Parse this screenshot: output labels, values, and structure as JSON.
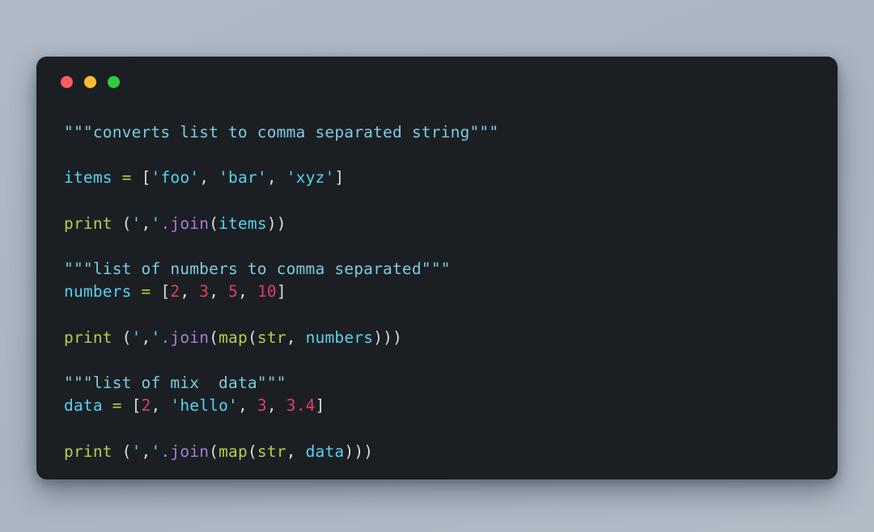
{
  "window": {
    "controls": [
      {
        "name": "close",
        "color": "#fa5c63"
      },
      {
        "name": "minimize",
        "color": "#fdbd2e"
      },
      {
        "name": "maximize",
        "color": "#2ecc40"
      }
    ]
  },
  "theme": {
    "page_background": "#adb8c5",
    "card_background": "#1b1f23",
    "docstring": "#7fcadf",
    "variable": "#57d2f0",
    "keyword": "#b6cd4b",
    "method": "#a77cd7",
    "number": "#dc415c",
    "punctuation": "#dcdcdc",
    "string": "#57d2f0"
  },
  "code": {
    "language": "python",
    "plain_text": "\"\"\"converts list to comma separated string\"\"\"\n\nitems = ['foo', 'bar', 'xyz']\n\nprint (','.join(items))\n\n\"\"\"list of numbers to comma separated\"\"\"\nnumbers = [2, 3, 5, 10]\n\nprint (','.join(map(str, numbers)))\n\n\"\"\"list of mix  data\"\"\"\ndata = [2, 'hello', 3, 3.4]\n\nprint (','.join(map(str, data)))",
    "lines": [
      {
        "id": "line-1",
        "tokens": [
          {
            "t": "\"\"\"converts list to comma separated string\"\"\"",
            "c": "doc"
          }
        ]
      },
      {
        "id": "line-2",
        "tokens": []
      },
      {
        "id": "line-3",
        "tokens": [
          {
            "t": "items",
            "c": "var"
          },
          {
            "t": " ",
            "c": "punct"
          },
          {
            "t": "=",
            "c": "op"
          },
          {
            "t": " ",
            "c": "punct"
          },
          {
            "t": "[",
            "c": "punct"
          },
          {
            "t": "'foo'",
            "c": "string"
          },
          {
            "t": ", ",
            "c": "punct"
          },
          {
            "t": "'bar'",
            "c": "string"
          },
          {
            "t": ", ",
            "c": "punct"
          },
          {
            "t": "'xyz'",
            "c": "string"
          },
          {
            "t": "]",
            "c": "punct"
          }
        ]
      },
      {
        "id": "line-4",
        "tokens": []
      },
      {
        "id": "line-5",
        "tokens": [
          {
            "t": "print",
            "c": "keyword"
          },
          {
            "t": " (",
            "c": "punct"
          },
          {
            "t": "'",
            "c": "string"
          },
          {
            "t": ",",
            "c": "punct"
          },
          {
            "t": "'",
            "c": "string"
          },
          {
            "t": ".join",
            "c": "method"
          },
          {
            "t": "(",
            "c": "punct"
          },
          {
            "t": "items",
            "c": "var"
          },
          {
            "t": "))",
            "c": "punct"
          }
        ]
      },
      {
        "id": "line-6",
        "tokens": []
      },
      {
        "id": "line-7",
        "tokens": [
          {
            "t": "\"\"\"list of numbers to comma separated\"\"\"",
            "c": "doc"
          }
        ]
      },
      {
        "id": "line-8",
        "tokens": [
          {
            "t": "numbers",
            "c": "var"
          },
          {
            "t": " ",
            "c": "punct"
          },
          {
            "t": "=",
            "c": "op"
          },
          {
            "t": " ",
            "c": "punct"
          },
          {
            "t": "[",
            "c": "punct"
          },
          {
            "t": "2",
            "c": "number"
          },
          {
            "t": ", ",
            "c": "punct"
          },
          {
            "t": "3",
            "c": "number"
          },
          {
            "t": ", ",
            "c": "punct"
          },
          {
            "t": "5",
            "c": "number"
          },
          {
            "t": ", ",
            "c": "punct"
          },
          {
            "t": "10",
            "c": "number"
          },
          {
            "t": "]",
            "c": "punct"
          }
        ]
      },
      {
        "id": "line-9",
        "tokens": []
      },
      {
        "id": "line-10",
        "tokens": [
          {
            "t": "print",
            "c": "keyword"
          },
          {
            "t": " (",
            "c": "punct"
          },
          {
            "t": "'",
            "c": "string"
          },
          {
            "t": ",",
            "c": "punct"
          },
          {
            "t": "'",
            "c": "string"
          },
          {
            "t": ".join",
            "c": "method"
          },
          {
            "t": "(",
            "c": "punct"
          },
          {
            "t": "map",
            "c": "keyword"
          },
          {
            "t": "(",
            "c": "punct"
          },
          {
            "t": "str",
            "c": "keyword"
          },
          {
            "t": ", ",
            "c": "punct"
          },
          {
            "t": "numbers",
            "c": "var"
          },
          {
            "t": ")))",
            "c": "punct"
          }
        ]
      },
      {
        "id": "line-11",
        "tokens": []
      },
      {
        "id": "line-12",
        "tokens": [
          {
            "t": "\"\"\"list of mix  data\"\"\"",
            "c": "doc"
          }
        ]
      },
      {
        "id": "line-13",
        "tokens": [
          {
            "t": "data",
            "c": "var"
          },
          {
            "t": " ",
            "c": "punct"
          },
          {
            "t": "=",
            "c": "op"
          },
          {
            "t": " ",
            "c": "punct"
          },
          {
            "t": "[",
            "c": "punct"
          },
          {
            "t": "2",
            "c": "number"
          },
          {
            "t": ", ",
            "c": "punct"
          },
          {
            "t": "'hello'",
            "c": "string"
          },
          {
            "t": ", ",
            "c": "punct"
          },
          {
            "t": "3",
            "c": "number"
          },
          {
            "t": ", ",
            "c": "punct"
          },
          {
            "t": "3.4",
            "c": "number"
          },
          {
            "t": "]",
            "c": "punct"
          }
        ]
      },
      {
        "id": "line-14",
        "tokens": []
      },
      {
        "id": "line-15",
        "tokens": [
          {
            "t": "print",
            "c": "keyword"
          },
          {
            "t": " (",
            "c": "punct"
          },
          {
            "t": "'",
            "c": "string"
          },
          {
            "t": ",",
            "c": "punct"
          },
          {
            "t": "'",
            "c": "string"
          },
          {
            "t": ".join",
            "c": "method"
          },
          {
            "t": "(",
            "c": "punct"
          },
          {
            "t": "map",
            "c": "keyword"
          },
          {
            "t": "(",
            "c": "punct"
          },
          {
            "t": "str",
            "c": "keyword"
          },
          {
            "t": ", ",
            "c": "punct"
          },
          {
            "t": "data",
            "c": "var"
          },
          {
            "t": ")))",
            "c": "punct"
          }
        ]
      }
    ]
  }
}
